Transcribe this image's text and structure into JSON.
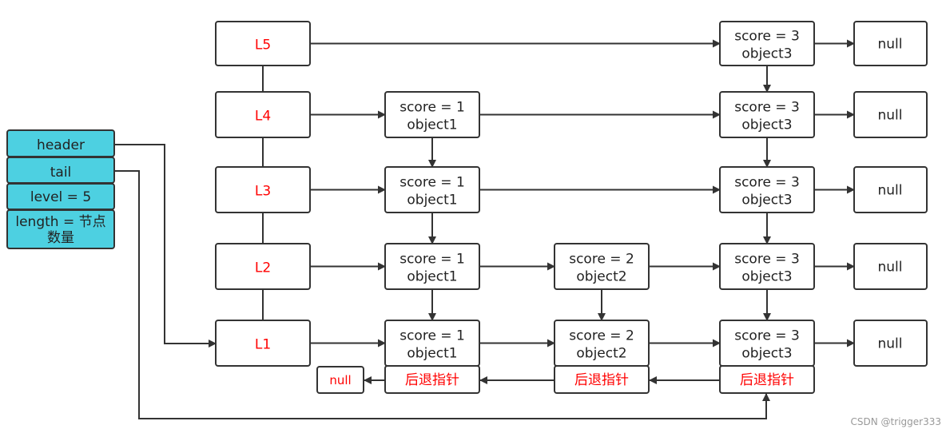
{
  "struct": {
    "fill_color": "#4dd0e1",
    "fields": [
      "header",
      "tail",
      "level = 5",
      "length = 节点",
      "数量"
    ]
  },
  "levels": [
    "L5",
    "L4",
    "L3",
    "L2",
    "L1"
  ],
  "label_color": "#ff0000",
  "columns": [
    {
      "score": "score = 1",
      "object": "object1",
      "levels": [
        "L4",
        "L3",
        "L2",
        "L1"
      ]
    },
    {
      "score": "score = 2",
      "object": "object2",
      "levels": [
        "L2",
        "L1"
      ]
    },
    {
      "score": "score = 3",
      "object": "object3",
      "levels": [
        "L5",
        "L4",
        "L3",
        "L2",
        "L1"
      ]
    }
  ],
  "null_label": "null",
  "backward_label": "后退指针",
  "watermark": "CSDN @trigger333"
}
